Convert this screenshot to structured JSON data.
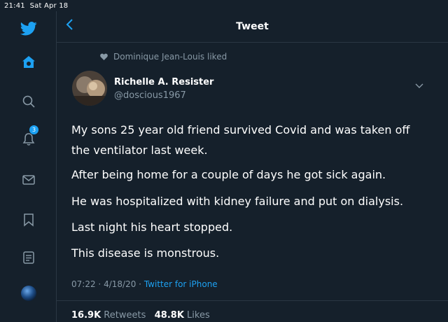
{
  "status_bar": {
    "time": "21:41",
    "date": "Sat Apr 18"
  },
  "sidebar": {
    "icons": [
      "twitter-logo",
      "home-icon",
      "search-icon",
      "bell-icon",
      "mail-icon",
      "bookmark-icon",
      "list-icon",
      "profile-avatar"
    ],
    "notification_count": "3"
  },
  "header": {
    "back_icon": "chevron-left",
    "title": "Tweet"
  },
  "social_context": {
    "text": "Dominique Jean-Louis liked"
  },
  "author": {
    "name": "Richelle A. Resister",
    "handle": "@doscious1967"
  },
  "tweet": {
    "lines": [
      "My sons 25 year old friend survived Covid and was taken off",
      "the ventilator last week.",
      "After being home for a couple of days he got sick again.",
      "He was hospitalized with kidney failure and put on dialysis.",
      "Last night his heart stopped.",
      "This disease is monstrous."
    ],
    "time": "07:22",
    "date": "4/18/20",
    "separator": "·",
    "source": "Twitter for iPhone"
  },
  "stats": {
    "retweets_count": "16.9K",
    "retweets_label": "Retweets",
    "likes_count": "48.8K",
    "likes_label": "Likes"
  },
  "colors": {
    "background": "#15202b",
    "accent": "#1da1f2",
    "muted": "#8899a6",
    "divider": "#2a3743"
  }
}
